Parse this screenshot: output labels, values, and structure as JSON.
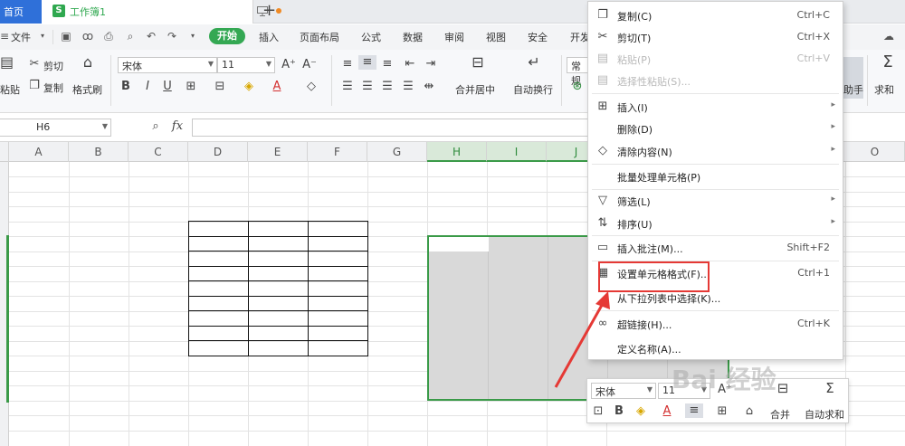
{
  "titlebar": {
    "home_tab": "首页",
    "workbook_tab": "工作簿1",
    "new_tab": "+"
  },
  "menubar": {
    "file": "文件",
    "start": "开始",
    "tabs": [
      "插入",
      "页面布局",
      "公式",
      "数据",
      "审阅",
      "视图",
      "安全",
      "开发"
    ]
  },
  "ribbon": {
    "paste": "粘贴",
    "cut": "剪切",
    "copy": "复制",
    "format_painter": "格式刷",
    "font_name": "宋体",
    "font_size": "11",
    "merge_center": "合并居中",
    "wrap_text": "自动换行",
    "number_format": "常规",
    "assistant": "助手",
    "sum": "求和"
  },
  "formula_bar": {
    "name_box": "H6",
    "fx": "fx"
  },
  "columns": [
    "A",
    "B",
    "C",
    "D",
    "E",
    "F",
    "G",
    "H",
    "I",
    "J",
    "O"
  ],
  "context_menu": {
    "items": [
      {
        "label": "复制(C)",
        "shortcut": "Ctrl+C"
      },
      {
        "label": "剪切(T)",
        "shortcut": "Ctrl+X"
      },
      {
        "label": "粘贴(P)",
        "shortcut": "Ctrl+V"
      },
      {
        "label": "选择性粘贴(S)..."
      },
      {
        "label": "插入(I)"
      },
      {
        "label": "删除(D)"
      },
      {
        "label": "清除内容(N)"
      },
      {
        "label": "批量处理单元格(P)"
      },
      {
        "label": "筛选(L)"
      },
      {
        "label": "排序(U)"
      },
      {
        "label": "插入批注(M)...",
        "shortcut": "Shift+F2"
      },
      {
        "label": "设置单元格格式(F)...",
        "shortcut": "Ctrl+1"
      },
      {
        "label": "从下拉列表中选择(K)..."
      },
      {
        "label": "超链接(H)...",
        "shortcut": "Ctrl+K"
      },
      {
        "label": "定义名称(A)..."
      }
    ]
  },
  "mini_toolbar": {
    "font_name": "宋体",
    "font_size": "11",
    "bold": "B",
    "merge": "合并",
    "autosum": "自动求和"
  },
  "watermark": "Bai 经验",
  "colors": {
    "accent_green": "#34a853",
    "home_blue": "#2f70d9",
    "highlight_red": "#e53935",
    "selection_fill": "#d9d9d9"
  }
}
